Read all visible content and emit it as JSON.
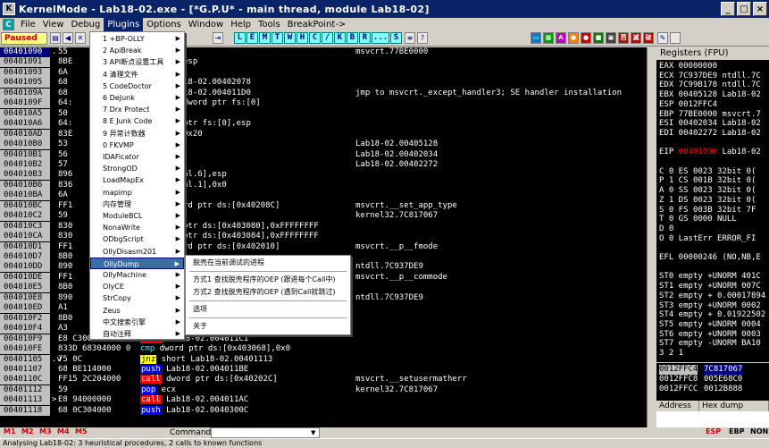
{
  "window": {
    "title": "KernelMode - Lab18-02.exe - [*G.P.U* - main thread, module Lab18-02]",
    "app_icon": "K",
    "min": "_",
    "max": "□",
    "close": "×"
  },
  "menubar": {
    "icon": "C",
    "items": [
      "File",
      "View",
      "Debug",
      "Plugins",
      "Options",
      "Window",
      "Help",
      "Tools",
      "BreakPoint->"
    ]
  },
  "toolbar": {
    "state": "Paused",
    "letters": [
      "L",
      "E",
      "M",
      "T",
      "W",
      "H",
      "C",
      "/",
      "K",
      "B",
      "R",
      "...",
      "S"
    ]
  },
  "cpu_rows": [
    {
      "addr": "00401090",
      "arrow": ".",
      "hex": "55",
      "dis": "",
      "com": "msvcrt.77BE0000",
      "sel": true
    },
    {
      "addr": "00401091",
      "arrow": "",
      "hex": "8BE",
      "dis": "esp",
      "com": ""
    },
    {
      "addr": "00401093",
      "arrow": "",
      "hex": "6A",
      "dis": "",
      "com": ""
    },
    {
      "addr": "00401095",
      "arrow": "",
      "hex": "68",
      "dis": "18-02.00402078",
      "com": ""
    },
    {
      "addr": "0040109A",
      "arrow": "",
      "hex": "68",
      "dis": "18-02.004011D0",
      "com": "jmp to msvcrt._except_handler3; SE handler installation"
    },
    {
      "addr": "0040109F",
      "arrow": "",
      "hex": "64:",
      "dis": "dword ptr fs:[0]",
      "com": ""
    },
    {
      "addr": "004010A5",
      "arrow": "",
      "hex": "50",
      "dis": "",
      "com": ""
    },
    {
      "addr": "004010A6",
      "arrow": "",
      "hex": "64:",
      "dis": "ptr fs:[0],esp",
      "com": ""
    },
    {
      "addr": "004010AD",
      "arrow": "",
      "hex": "83E",
      "dis": "0x20",
      "com": ""
    },
    {
      "addr": "004010B0",
      "arrow": "",
      "hex": "53",
      "dis": "",
      "com": "Lab18-02.00405128"
    },
    {
      "addr": "004010B1",
      "arrow": "",
      "hex": "56",
      "dis": "",
      "com": "Lab18-02.00402034"
    },
    {
      "addr": "004010B2",
      "arrow": "",
      "hex": "57",
      "dis": "",
      "com": "Lab18-02.00402272"
    },
    {
      "addr": "004010B3",
      "arrow": "",
      "hex": "896",
      "dis": "al.6],esp",
      "com": ""
    },
    {
      "addr": "004010B6",
      "arrow": "",
      "hex": "836",
      "dis": "al.1],0x0",
      "com": ""
    },
    {
      "addr": "004010BA",
      "arrow": "",
      "hex": "6A",
      "dis": "",
      "com": ""
    },
    {
      "addr": "004010BC",
      "arrow": "",
      "hex": "FF1",
      "dis": "rd ptr ds:[0x40208C]",
      "com": "msvcrt.__set_app_type"
    },
    {
      "addr": "004010C2",
      "arrow": "",
      "hex": "59",
      "dis": "",
      "com": "kernel32.7C817067"
    },
    {
      "addr": "004010C3",
      "arrow": "",
      "hex": "830",
      "dis": "ptr ds:[0x403080],0xFFFFFFFF",
      "com": ""
    },
    {
      "addr": "004010CA",
      "arrow": "",
      "hex": "830",
      "dis": "ptr ds:[0x403084],0xFFFFFFFF",
      "com": ""
    },
    {
      "addr": "004010D1",
      "arrow": "",
      "hex": "FF1",
      "dis": "rd ptr ds:[0x402010]",
      "com": "msvcrt.__p__fmode"
    },
    {
      "addr": "004010D7",
      "arrow": "",
      "hex": "8B0",
      "dis": "",
      "com": ""
    },
    {
      "addr": "004010DD",
      "arrow": "",
      "hex": "890",
      "dis": "",
      "com": "ntdll.7C937DE9"
    },
    {
      "addr": "004010DE",
      "arrow": "",
      "hex": "FF1",
      "dis": "",
      "com": "msvcrt.__p__commode"
    },
    {
      "addr": "004010E5",
      "arrow": "",
      "hex": "8B0",
      "dis": "",
      "com": ""
    },
    {
      "addr": "004010E8",
      "arrow": "",
      "hex": "890",
      "dis": "",
      "com": "ntdll.7C937DE9"
    },
    {
      "addr": "004010ED",
      "arrow": "",
      "hex": "A1",
      "dis": "",
      "com": ""
    },
    {
      "addr": "004010F2",
      "arrow": "",
      "hex": "8B0",
      "dis": "",
      "com": ""
    },
    {
      "addr": "004010F4",
      "arrow": "",
      "hex": "A3",
      "dis": "ptr ds:[0x403088],eax",
      "com": ""
    },
    {
      "addr": "004010F9",
      "arrow": "",
      "hex": "E8 C3000000",
      "dis": "Lab18-02.004011C1",
      "com": "",
      "kw": "call"
    },
    {
      "addr": "004010FE",
      "arrow": "",
      "hex": "833D 68304000 0",
      "dis": "dword ptr ds:[0x403068],0x0",
      "com": "",
      "kw": "cmp"
    },
    {
      "addr": "00401105",
      "arrow": ".v",
      "hex": "75 0C",
      "dis": "short Lab18-02.00401113",
      "com": "",
      "kw": "jnz"
    },
    {
      "addr": "00401107",
      "arrow": "",
      "hex": "68 BE114000",
      "dis": "Lab18-02.004011BE",
      "com": "",
      "kw": "push"
    },
    {
      "addr": "0040110C",
      "arrow": "",
      "hex": "FF15 2C204000",
      "dis": "dword ptr ds:[0x40202C]",
      "com": "msvcrt.__setusermatherr",
      "kw": "call"
    },
    {
      "addr": "00401112",
      "arrow": "",
      "hex": "59",
      "dis": "ecx",
      "com": "kernel32.7C817067",
      "kw": "pop"
    },
    {
      "addr": "00401113",
      "arrow": ">",
      "hex": "E8 94000000",
      "dis": "Lab18-02.004011AC",
      "com": "",
      "kw": "call"
    },
    {
      "addr": "00401118",
      "arrow": "",
      "hex": "68 0C304000",
      "dis": "Lab18-02.0040300C",
      "com": "",
      "kw": "push"
    }
  ],
  "registers": {
    "header": "Registers (FPU)",
    "lines": [
      {
        "n": "EAX",
        "v": "00000000",
        "c": ""
      },
      {
        "n": "ECX",
        "v": "7C937DE9",
        "c": "ntdll.7C"
      },
      {
        "n": "EDX",
        "v": "7C99B178",
        "c": "ntdll.7C"
      },
      {
        "n": "EBX",
        "v": "00405128",
        "c": "Lab18-02"
      },
      {
        "n": "ESP",
        "v": "0012FFC4",
        "c": ""
      },
      {
        "n": "EBP",
        "v": "77BE0000",
        "c": "msvcrt.7"
      },
      {
        "n": "ESI",
        "v": "00402034",
        "c": "Lab18-02"
      },
      {
        "n": "EDI",
        "v": "00402272",
        "c": "Lab18-02"
      },
      {
        "n": "",
        "v": "",
        "c": ""
      },
      {
        "n": "EIP",
        "v": "00401090",
        "c": "Lab18-02",
        "red": true
      },
      {
        "n": "",
        "v": "",
        "c": ""
      },
      {
        "n": "C 0",
        "v": "ES 0023",
        "c": "32bit 0("
      },
      {
        "n": "P 1",
        "v": "CS 001B",
        "c": "32bit 0("
      },
      {
        "n": "A 0",
        "v": "SS 0023",
        "c": "32bit 0("
      },
      {
        "n": "Z 1",
        "v": "DS 0023",
        "c": "32bit 0("
      },
      {
        "n": "S 0",
        "v": "FS 003B",
        "c": "32bit 7F"
      },
      {
        "n": "T 0",
        "v": "GS 0000",
        "c": "NULL"
      },
      {
        "n": "D 0",
        "v": "",
        "c": ""
      },
      {
        "n": "O 0",
        "v": "LastErr",
        "c": "ERROR_FI"
      },
      {
        "n": "",
        "v": "",
        "c": ""
      },
      {
        "n": "EFL",
        "v": "00000246",
        "c": "(NO,NB,E"
      },
      {
        "n": "",
        "v": "",
        "c": ""
      },
      {
        "n": "ST0",
        "v": "empty",
        "c": "+UNORM 401C"
      },
      {
        "n": "ST1",
        "v": "empty",
        "c": "+UNORM 007C"
      },
      {
        "n": "ST2",
        "v": "empty",
        "c": "+ 0.00017894"
      },
      {
        "n": "ST3",
        "v": "empty",
        "c": "+UNORM 0002"
      },
      {
        "n": "ST4",
        "v": "empty",
        "c": "+ 0.01922502"
      },
      {
        "n": "ST5",
        "v": "empty",
        "c": "+UNORM 0004"
      },
      {
        "n": "ST6",
        "v": "empty",
        "c": "+UNORM 0003"
      },
      {
        "n": "ST7",
        "v": "empty",
        "c": "-UNORM BA10"
      },
      {
        "n": "",
        "v": "",
        "c": "3 2 1"
      }
    ]
  },
  "stack": [
    {
      "a": "0012FFC4",
      "v": "7C817067",
      "sel": true
    },
    {
      "a": "0012FFC8",
      "v": "005E68C0"
    },
    {
      "a": "0012FFCC",
      "v": "0012B888"
    }
  ],
  "dump": {
    "tabs": [
      "Address",
      "Hex dump"
    ]
  },
  "cmdbar": {
    "tabs": [
      "M1",
      "M2",
      "M3",
      "M4",
      "M5"
    ],
    "command_label": "Command:",
    "reg_tabs": [
      "ESP",
      "EBP",
      "NONE"
    ]
  },
  "status": "Analysing Lab18-02: 3 heuristical procedures, 2 calls to known functions",
  "plugins_menu": [
    {
      "label": "1 +BP-OLLY",
      "arrow": true
    },
    {
      "label": "2 ApiBreak",
      "arrow": true
    },
    {
      "label": "3 API断点设置工具",
      "arrow": true
    },
    {
      "label": "4 清理文件",
      "arrow": true
    },
    {
      "label": "5 CodeDoctor",
      "arrow": true
    },
    {
      "label": "6 DeJunk",
      "arrow": true
    },
    {
      "label": "7 Drx Protect",
      "arrow": true
    },
    {
      "label": "8 E Junk Code",
      "arrow": true
    },
    {
      "label": "9 异常计数器",
      "arrow": true
    },
    {
      "label": "0 FKVMP",
      "arrow": true
    },
    {
      "label": "IDAFicator",
      "arrow": true
    },
    {
      "label": "StrongOD",
      "arrow": true
    },
    {
      "label": "LoadMapEx",
      "arrow": true
    },
    {
      "label": "mapimp",
      "arrow": true
    },
    {
      "label": "内存管理",
      "arrow": true
    },
    {
      "label": "ModuleBCL",
      "arrow": true
    },
    {
      "label": "NonaWrite",
      "arrow": true
    },
    {
      "label": "ODbgScript",
      "arrow": true
    },
    {
      "label": "OllyDisasm201",
      "arrow": true
    },
    {
      "label": "OllyDump",
      "arrow": true,
      "hl": true
    },
    {
      "label": "OllyMachine",
      "arrow": true
    },
    {
      "label": "OlyCE",
      "arrow": true
    },
    {
      "label": "StrCopy",
      "arrow": true
    },
    {
      "label": "Zeus",
      "arrow": true
    },
    {
      "label": "中文搜索引擎",
      "arrow": true
    },
    {
      "label": "自动注释",
      "arrow": true
    }
  ],
  "olly_submenu": [
    "脱壳在当前调试的进程",
    "方式1 查找脱壳程序的OEP (跟进每个Call中)",
    "方式2 查找脱壳程序的OEP (遇到Call就跳过)",
    "选项",
    "关于"
  ],
  "colors": {
    "title_bg": "#0a246a",
    "cpu_bg": "#000000",
    "call_bg": "#ff0000",
    "push_bg": "#0000ff",
    "jump_bg": "#ffff00",
    "menu_highlight": "#3a6ea5"
  }
}
